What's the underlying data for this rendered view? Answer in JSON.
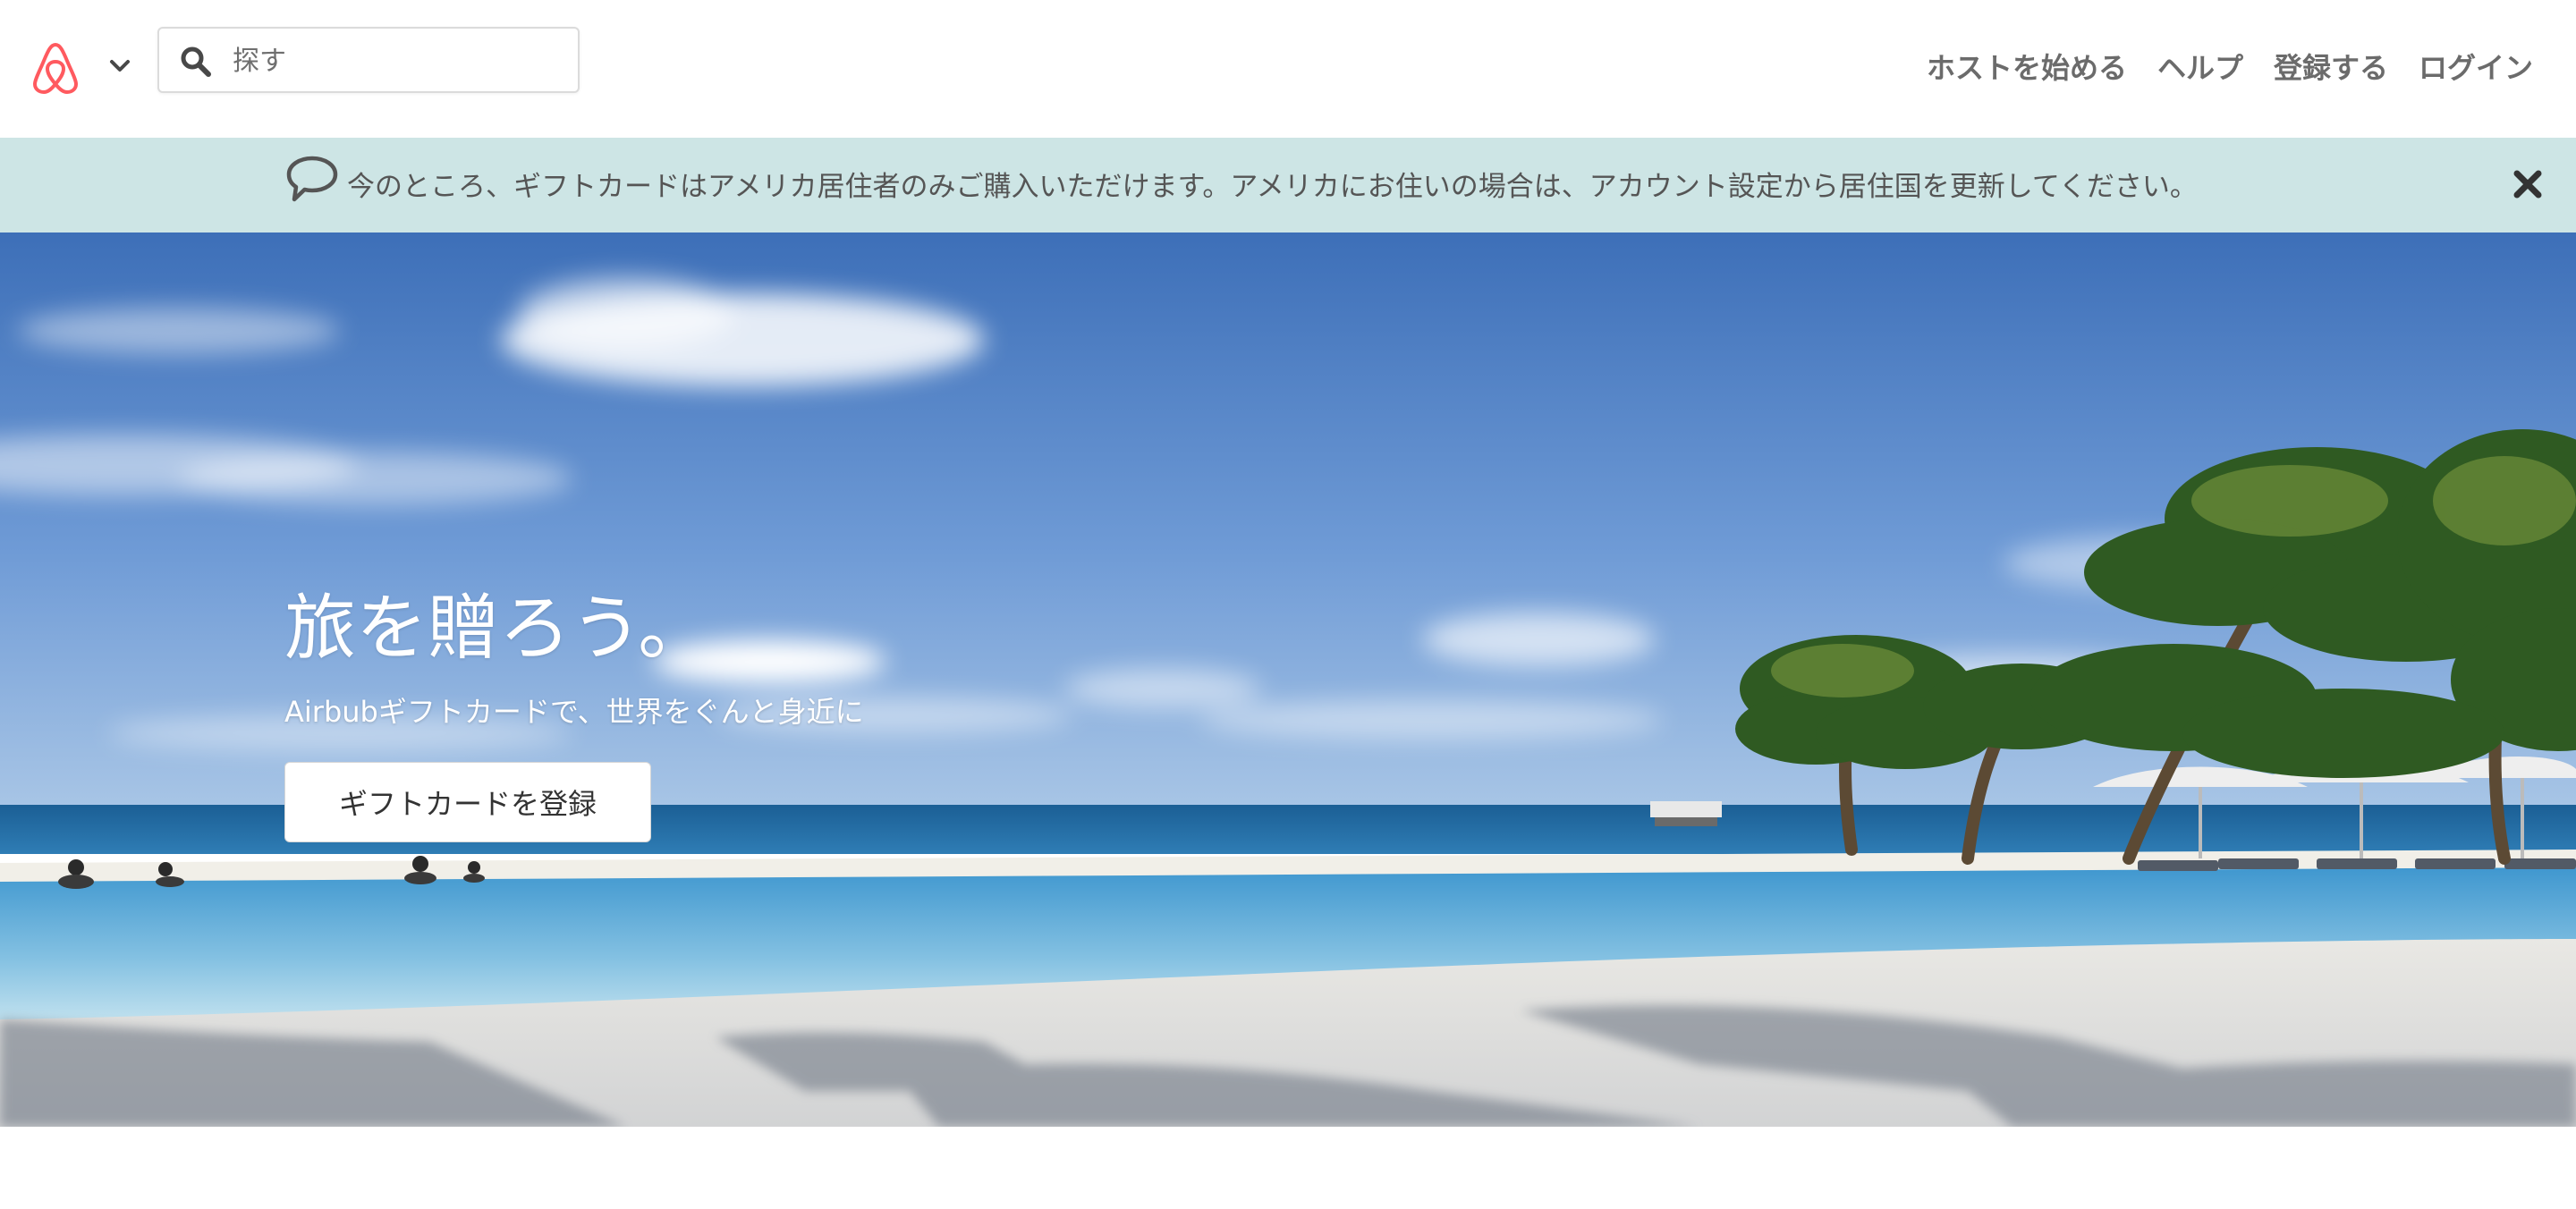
{
  "header": {
    "logo_icon": "airbnb-logo-icon",
    "menu_icon": "chevron-down-icon",
    "search": {
      "icon": "search-icon",
      "placeholder": "探す",
      "value": ""
    },
    "nav": {
      "host_label": "ホストを始める",
      "help_label": "ヘルプ",
      "signup_label": "登録する",
      "login_label": "ログイン"
    }
  },
  "notice": {
    "icon": "speech-bubble-icon",
    "text": "今のところ、ギフトカードはアメリカ居住者のみご購入いただけます。アメリカにお住いの場合は、アカウント設定から居住国を更新してください。",
    "close_icon": "close-icon",
    "background_color": "#cde5e5"
  },
  "hero": {
    "title": "旅を贈ろう。",
    "subtitle": "Airbubギフトカードで、世界をぐんと身近に",
    "button_label": "ギフトカードを登録"
  },
  "colors": {
    "brand": "#ff5a5f",
    "nav_text": "#6b6b6b",
    "sky": "#4d82cc",
    "sea": "#1c6fa8"
  }
}
